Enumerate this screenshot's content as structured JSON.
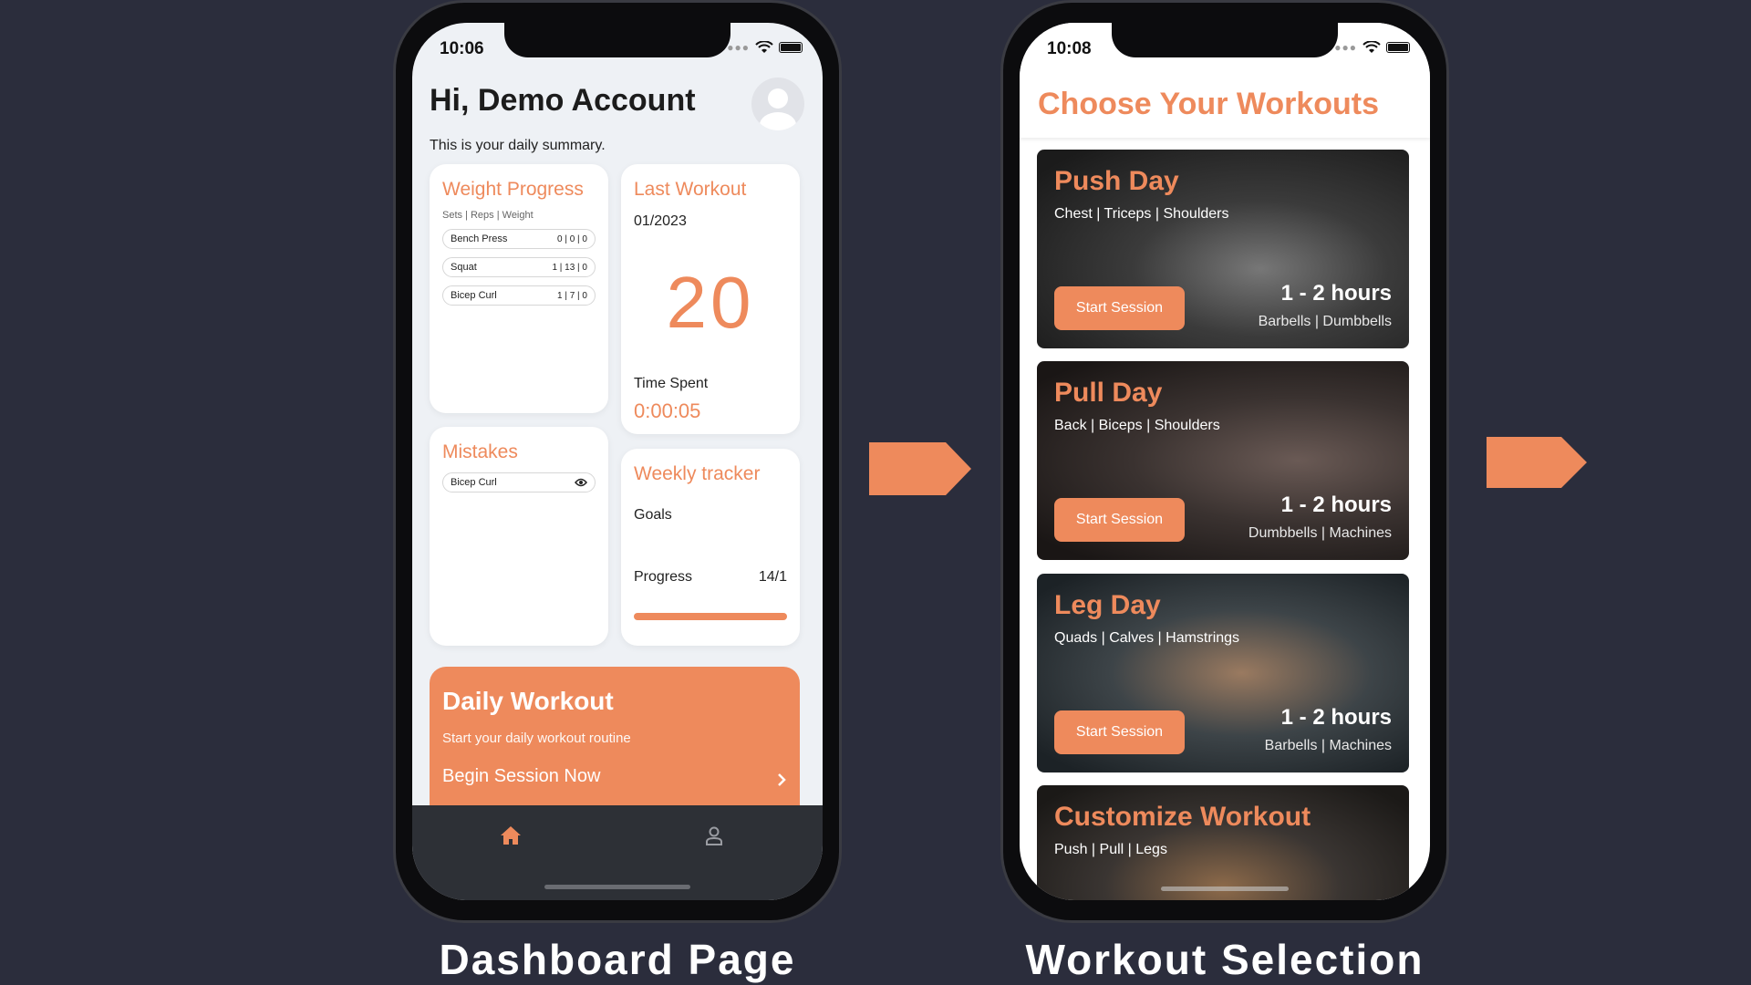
{
  "dashboard": {
    "status_time": "10:06",
    "greeting": "Hi, Demo Account",
    "subtitle": "This is your daily summary.",
    "weight_progress": {
      "title": "Weight Progress",
      "columns": "Sets | Reps | Weight",
      "rows": [
        {
          "name": "Bench Press",
          "value": "0 | 0 | 0"
        },
        {
          "name": "Squat",
          "value": "1 | 13 | 0"
        },
        {
          "name": "Bicep Curl",
          "value": "1 | 7 | 0"
        }
      ]
    },
    "last_workout": {
      "title": "Last Workout",
      "date": "01/2023",
      "number": "20",
      "time_label": "Time Spent",
      "time_value": "0:00:05"
    },
    "mistakes": {
      "title": "Mistakes",
      "rows": [
        {
          "name": "Bicep Curl"
        }
      ]
    },
    "weekly_tracker": {
      "title": "Weekly tracker",
      "goals_label": "Goals",
      "progress_label": "Progress",
      "progress_value": "14/1",
      "progress_fraction": 1.0
    },
    "daily_workout": {
      "title": "Daily Workout",
      "subtitle": "Start your daily workout routine",
      "cta": "Begin Session Now"
    }
  },
  "workouts": {
    "status_time": "10:08",
    "title": "Choose Your Workouts",
    "cards": [
      {
        "name": "Push Day",
        "muscles": "Chest | Triceps | Shoulders",
        "button": "Start Session",
        "duration": "1 - 2 hours",
        "equipment": "Barbells | Dumbbells"
      },
      {
        "name": "Pull Day",
        "muscles": "Back | Biceps | Shoulders",
        "button": "Start Session",
        "duration": "1 - 2 hours",
        "equipment": "Dumbbells | Machines"
      },
      {
        "name": "Leg Day",
        "muscles": "Quads | Calves | Hamstrings",
        "button": "Start Session",
        "duration": "1 - 2 hours",
        "equipment": "Barbells | Machines"
      },
      {
        "name": "Customize Workout",
        "muscles": "Push | Pull | Legs"
      }
    ]
  },
  "captions": {
    "dashboard": "Dashboard Page",
    "workouts": "Workout Selection"
  },
  "colors": {
    "accent": "#ee8a5c",
    "background": "#2b2d3c",
    "tabbar": "#2d3036"
  }
}
